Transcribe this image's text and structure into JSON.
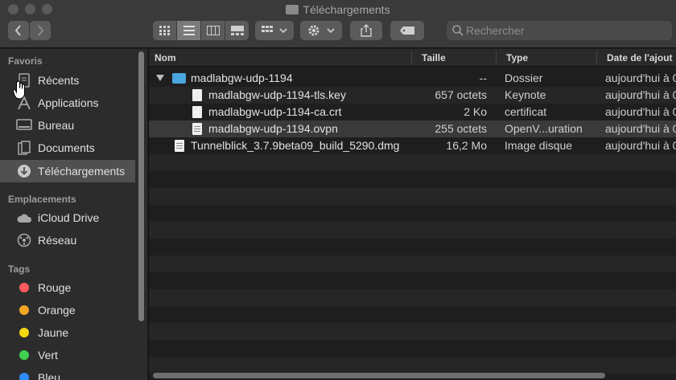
{
  "window": {
    "title": "Téléchargements"
  },
  "search": {
    "placeholder": "Rechercher"
  },
  "sidebar": {
    "favorites_heading": "Favoris",
    "favorites": [
      {
        "label": "Récents",
        "icon": "recents-icon"
      },
      {
        "label": "Applications",
        "icon": "applications-icon"
      },
      {
        "label": "Bureau",
        "icon": "desktop-icon"
      },
      {
        "label": "Documents",
        "icon": "documents-icon"
      },
      {
        "label": "Téléchargements",
        "icon": "downloads-icon",
        "selected": true
      }
    ],
    "locations_heading": "Emplacements",
    "locations": [
      {
        "label": "iCloud Drive",
        "icon": "cloud-icon"
      },
      {
        "label": "Réseau",
        "icon": "network-icon"
      }
    ],
    "tags_heading": "Tags",
    "tags": [
      {
        "label": "Rouge",
        "color": "#ff5b5b"
      },
      {
        "label": "Orange",
        "color": "#f5a623"
      },
      {
        "label": "Jaune",
        "color": "#f6d90f"
      },
      {
        "label": "Vert",
        "color": "#3ed14f"
      },
      {
        "label": "Bleu",
        "color": "#2f8cff"
      }
    ]
  },
  "columns": {
    "name": "Nom",
    "size": "Taille",
    "kind": "Type",
    "date": "Date de l'ajout"
  },
  "files": [
    {
      "name": "madlabgw-udp-1194",
      "size": "--",
      "kind": "Dossier",
      "date": "aujourd'hui à 0",
      "type": "folder"
    },
    {
      "name": "madlabgw-udp-1194-tls.key",
      "size": "657 octets",
      "kind": "Keynote",
      "date": "aujourd'hui à 0",
      "type": "file"
    },
    {
      "name": "madlabgw-udp-1194-ca.crt",
      "size": "2 Ko",
      "kind": "certificat",
      "date": "aujourd'hui à 0",
      "type": "file"
    },
    {
      "name": "madlabgw-udp-1194.ovpn",
      "size": "255 octets",
      "kind": "OpenV...uration",
      "date": "aujourd'hui à 0",
      "type": "config"
    },
    {
      "name": "Tunnelblick_3.7.9beta09_build_5290.dmg",
      "size": "16,2 Mo",
      "kind": "Image disque",
      "date": "aujourd'hui à 0",
      "type": "disk"
    }
  ]
}
